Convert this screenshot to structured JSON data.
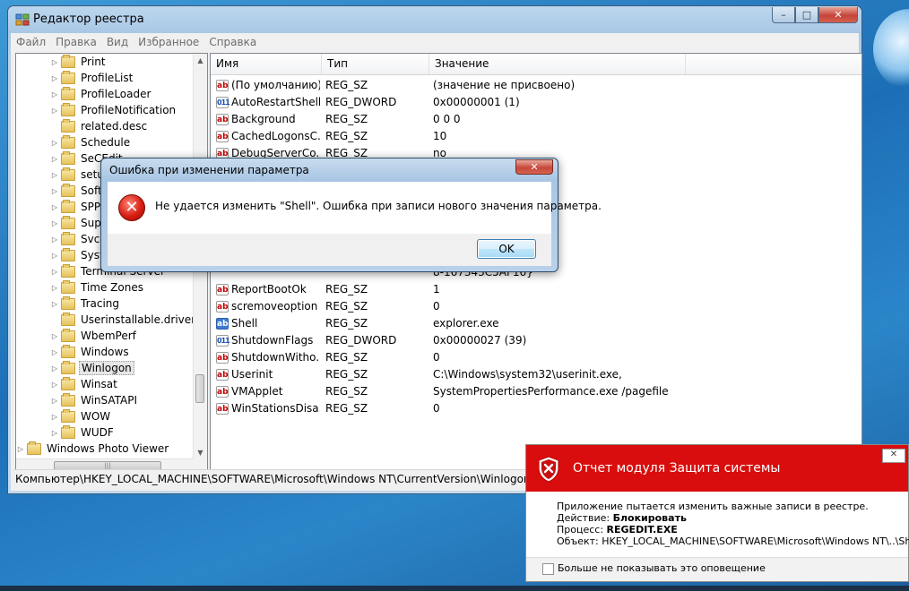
{
  "window": {
    "title": "Редактор реестра",
    "min_glyph": "–",
    "max_glyph": "□",
    "close_glyph": "✕"
  },
  "menu": [
    "Файл",
    "Правка",
    "Вид",
    "Избранное",
    "Справка"
  ],
  "tree": {
    "items": [
      {
        "label": "Print",
        "arrow": "▷"
      },
      {
        "label": "ProfileList",
        "arrow": "▷"
      },
      {
        "label": "ProfileLoader",
        "arrow": "▷"
      },
      {
        "label": "ProfileNotification",
        "arrow": "▷"
      },
      {
        "label": "related.desc",
        "arrow": ""
      },
      {
        "label": "Schedule",
        "arrow": "▷"
      },
      {
        "label": "SeCEdit",
        "arrow": "▷"
      },
      {
        "label": "setup",
        "arrow": "▷"
      },
      {
        "label": "Software",
        "arrow": "▷"
      },
      {
        "label": "SPP",
        "arrow": "▷"
      },
      {
        "label": "Superfetch",
        "arrow": "▷"
      },
      {
        "label": "Svchost",
        "arrow": "▷"
      },
      {
        "label": "SystemRestore",
        "arrow": "▷"
      },
      {
        "label": "Terminal Server",
        "arrow": "▷"
      },
      {
        "label": "Time Zones",
        "arrow": "▷"
      },
      {
        "label": "Tracing",
        "arrow": "▷"
      },
      {
        "label": "Userinstallable.drivers",
        "arrow": ""
      },
      {
        "label": "WbemPerf",
        "arrow": "▷"
      },
      {
        "label": "Windows",
        "arrow": "▷"
      },
      {
        "label": "Winlogon",
        "arrow": "▷"
      },
      {
        "label": "Winsat",
        "arrow": "▷"
      },
      {
        "label": "WinSATAPI",
        "arrow": "▷"
      },
      {
        "label": "WOW",
        "arrow": "▷"
      },
      {
        "label": "WUDF",
        "arrow": "▷"
      },
      {
        "label": "Windows Photo Viewer",
        "arrow": "▷"
      }
    ],
    "selected": "Winlogon"
  },
  "list": {
    "columns": [
      "Имя",
      "Тип",
      "Значение"
    ],
    "rows": [
      {
        "name": "(По умолчанию)",
        "type": "REG_SZ",
        "value": "(значение не присвоено)",
        "icon": "ab"
      },
      {
        "name": "AutoRestartShell",
        "type": "REG_DWORD",
        "value": "0x00000001 (1)",
        "icon": "bin"
      },
      {
        "name": "Background",
        "type": "REG_SZ",
        "value": "0 0 0",
        "icon": "ab"
      },
      {
        "name": "CachedLogonsC...",
        "type": "REG_SZ",
        "value": "10",
        "icon": "ab"
      },
      {
        "name": "DebugServerCo...",
        "type": "REG_SZ",
        "value": "no",
        "icon": "ab"
      },
      {
        "name": "",
        "type": "",
        "value": "8-167343C5AF16}",
        "icon": "none"
      },
      {
        "name": "ReportBootOk",
        "type": "REG_SZ",
        "value": "1",
        "icon": "ab"
      },
      {
        "name": "scremoveoption",
        "type": "REG_SZ",
        "value": "0",
        "icon": "ab"
      },
      {
        "name": "Shell",
        "type": "REG_SZ",
        "value": "explorer.exe",
        "icon": "ab-sel"
      },
      {
        "name": "ShutdownFlags",
        "type": "REG_DWORD",
        "value": "0x00000027 (39)",
        "icon": "bin"
      },
      {
        "name": "ShutdownWitho...",
        "type": "REG_SZ",
        "value": "0",
        "icon": "ab"
      },
      {
        "name": "Userinit",
        "type": "REG_SZ",
        "value": "C:\\Windows\\system32\\userinit.exe,",
        "icon": "ab"
      },
      {
        "name": "VMApplet",
        "type": "REG_SZ",
        "value": "SystemPropertiesPerformance.exe /pagefile",
        "icon": "ab"
      },
      {
        "name": "WinStationsDisa...",
        "type": "REG_SZ",
        "value": "0",
        "icon": "ab"
      }
    ]
  },
  "statusbar": "Компьютер\\HKEY_LOCAL_MACHINE\\SOFTWARE\\Microsoft\\Windows NT\\CurrentVersion\\Winlogon",
  "dialog": {
    "title": "Ошибка при изменении параметра",
    "message": "Не удается изменить \"Shell\".  Ошибка при записи нового значения параметра.",
    "ok": "OK",
    "close_glyph": "✕",
    "error_glyph": "✕"
  },
  "notification": {
    "title": "Отчет модуля Защита системы",
    "close_glyph": "✕",
    "line1": "Приложение пытается изменить важные записи в реестре.",
    "action_label": "Действие: ",
    "action_value": "Блокировать",
    "process_label": "Процесс: ",
    "process_value": "REGEDIT.EXE",
    "object_label": "Объект: ",
    "object_value": "HKEY_LOCAL_MACHINE\\SOFTWARE\\Microsoft\\Windows NT\\..\\Shell",
    "checkbox": "Больше не показывать это оповещение"
  },
  "colors": {
    "notif_red": "#d90d0d",
    "selection": "#3d7bd1"
  }
}
